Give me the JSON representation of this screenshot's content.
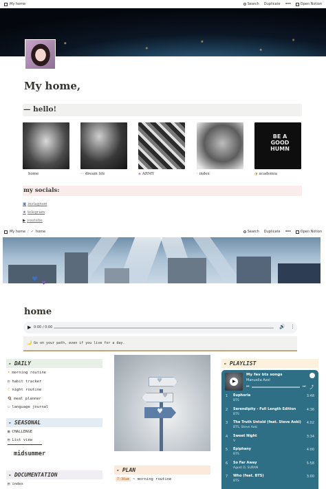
{
  "window1": {
    "breadcrumb": "My home",
    "search": "Search",
    "duplicate": "Duplicate",
    "more": "•••",
    "open": "Open Notion"
  },
  "window2": {
    "crumb_root": "My home",
    "crumb_sep": "/",
    "crumb_page": "home",
    "search": "Search",
    "duplicate": "Duplicate",
    "more": "•••",
    "open": "Open Notion"
  },
  "page1": {
    "title": "My home,",
    "hello": "— hello!",
    "gallery": [
      {
        "label": "home",
        "icon": ""
      },
      {
        "label": "dream life",
        "icon": "⋯"
      },
      {
        "label": "ARMY",
        "icon": "◈"
      },
      {
        "label": "index",
        "icon": "·"
      },
      {
        "label": "academia",
        "icon": "◑"
      }
    ],
    "socials_title": "my socials:",
    "socials": [
      {
        "label": "instagram",
        "icon": "▣"
      },
      {
        "label": "telegram",
        "icon": "★"
      },
      {
        "label": "youtube",
        "icon": "▶"
      }
    ]
  },
  "page2": {
    "title": "home",
    "audio_time": "0:00 / 0:00",
    "quote_icon": "🌙",
    "quote": "Go on your path, even if you live for a day.",
    "daily": {
      "title": "DAILY",
      "items": [
        {
          "label": "morning routine",
          "icon": "☀"
        },
        {
          "label": "habit tracker",
          "icon": "▤"
        },
        {
          "label": "night routine",
          "icon": "☾"
        },
        {
          "label": "meal planner",
          "icon": "🍳"
        },
        {
          "label": "language journal",
          "icon": "▭"
        }
      ]
    },
    "seasonal": {
      "title": "SEASONAL",
      "items": [
        {
          "label": "CHALLENGE",
          "icon": "▦"
        },
        {
          "label": "List view",
          "icon": "▤"
        }
      ],
      "subtitle": "midsummer"
    },
    "documentation": {
      "title": "DOCUMENTATION",
      "items": [
        {
          "label": "index",
          "icon": "▤"
        }
      ]
    },
    "plan": {
      "title": "PLAN",
      "time": "7:30am",
      "item": "~ morning routine"
    },
    "playlist": {
      "title": "PLAYLIST",
      "name": "My fav bts songs",
      "owner": "Manuella Azol",
      "tracks": [
        {
          "num": "1",
          "name": "Euphoria",
          "artist": "BTS",
          "dur": "3:48"
        },
        {
          "num": "2",
          "name": "Serendipity - Full Length Edition",
          "artist": "BTS",
          "dur": "4:36"
        },
        {
          "num": "3",
          "name": "The Truth Untold (feat. Steve Aoki)",
          "artist": "BTS, Steve Aoki",
          "dur": "4:02"
        },
        {
          "num": "4",
          "name": "Sweet Night",
          "artist": "V",
          "dur": "3:34"
        },
        {
          "num": "5",
          "name": "Epiphany",
          "artist": "BTS",
          "dur": "4:00"
        },
        {
          "num": "6",
          "name": "So Far Away",
          "artist": "Agust D, SURAN",
          "dur": "5:58"
        },
        {
          "num": "7",
          "name": "Who (feat. BTS)",
          "artist": "BTS",
          "dur": "3:00"
        }
      ]
    }
  },
  "colors": {
    "hello_bg": "#f1f1ef",
    "socials_bg": "#fbecec",
    "daily_bg": "#e8efe6",
    "seasonal_bg": "#e3ecf3",
    "doc_bg": "#f0eef3",
    "plan_bg": "#fbead9",
    "playlist_bg": "#fbf1dd",
    "spotify_bg": "#2e6f86"
  }
}
